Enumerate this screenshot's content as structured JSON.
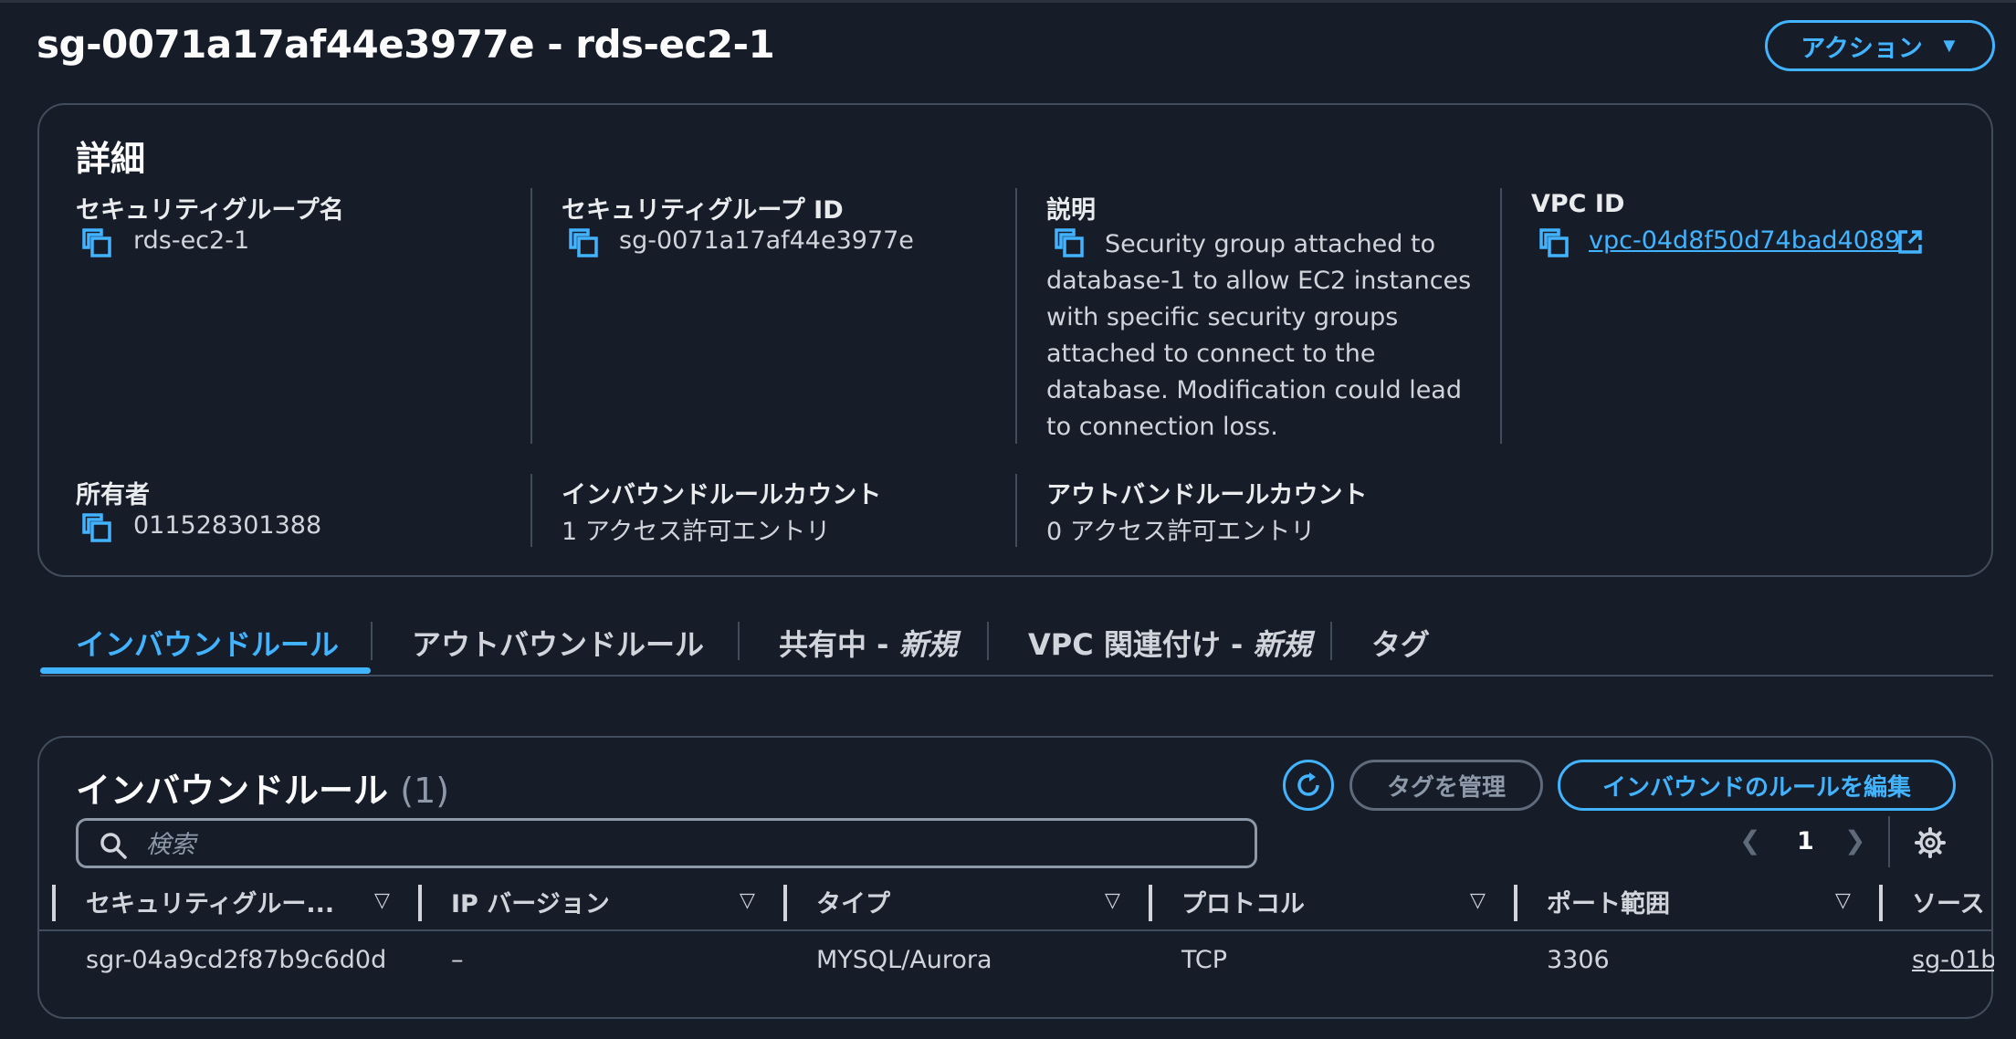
{
  "header": {
    "title": "sg-0071a17af44e3977e - rds-ec2-1",
    "actions_label": "アクション"
  },
  "details": {
    "title": "詳細",
    "sg_name_label": "セキュリティグループ名",
    "sg_name": "rds-ec2-1",
    "sg_id_label": "セキュリティグループ ID",
    "sg_id": "sg-0071a17af44e3977e",
    "description_label": "説明",
    "description": "Security group attached to database-1 to allow EC2 instances with specific security groups attached to connect to the database. Modification could lead to connection loss.",
    "vpc_id_label": "VPC ID",
    "vpc_id": "vpc-04d8f50d74bad4089",
    "owner_label": "所有者",
    "owner": "011528301388",
    "inbound_count_label": "インバウンドルールカウント",
    "inbound_count": "1 アクセス許可エントリ",
    "outbound_count_label": "アウトバンドルールカウント",
    "outbound_count": "0 アクセス許可エントリ"
  },
  "tabs": [
    {
      "label": "インバウンドルール",
      "suffix": ""
    },
    {
      "label": "アウトバウンドルール",
      "suffix": ""
    },
    {
      "label": "共有中 - ",
      "suffix": "新規"
    },
    {
      "label": "VPC 関連付け - ",
      "suffix": "新規"
    },
    {
      "label": "タグ",
      "suffix": ""
    }
  ],
  "rules": {
    "title": "インバウンドルール",
    "count": "(1)",
    "manage_tags_label": "タグを管理",
    "edit_label": "インバウンドのルールを編集",
    "search_placeholder": "検索",
    "page": "1",
    "columns": [
      "セキュリティグルー...",
      "IP バージョン",
      "タイプ",
      "プロトコル",
      "ポート範囲",
      "ソース"
    ],
    "rows": [
      [
        "sgr-04a9cd2f87b9c6d0d",
        "–",
        "MYSQL/Aurora",
        "TCP",
        "3306",
        "sg-01b"
      ]
    ]
  },
  "colors": {
    "background": "#161d29",
    "accent": "#42b4ff",
    "border": "#414d5c"
  }
}
